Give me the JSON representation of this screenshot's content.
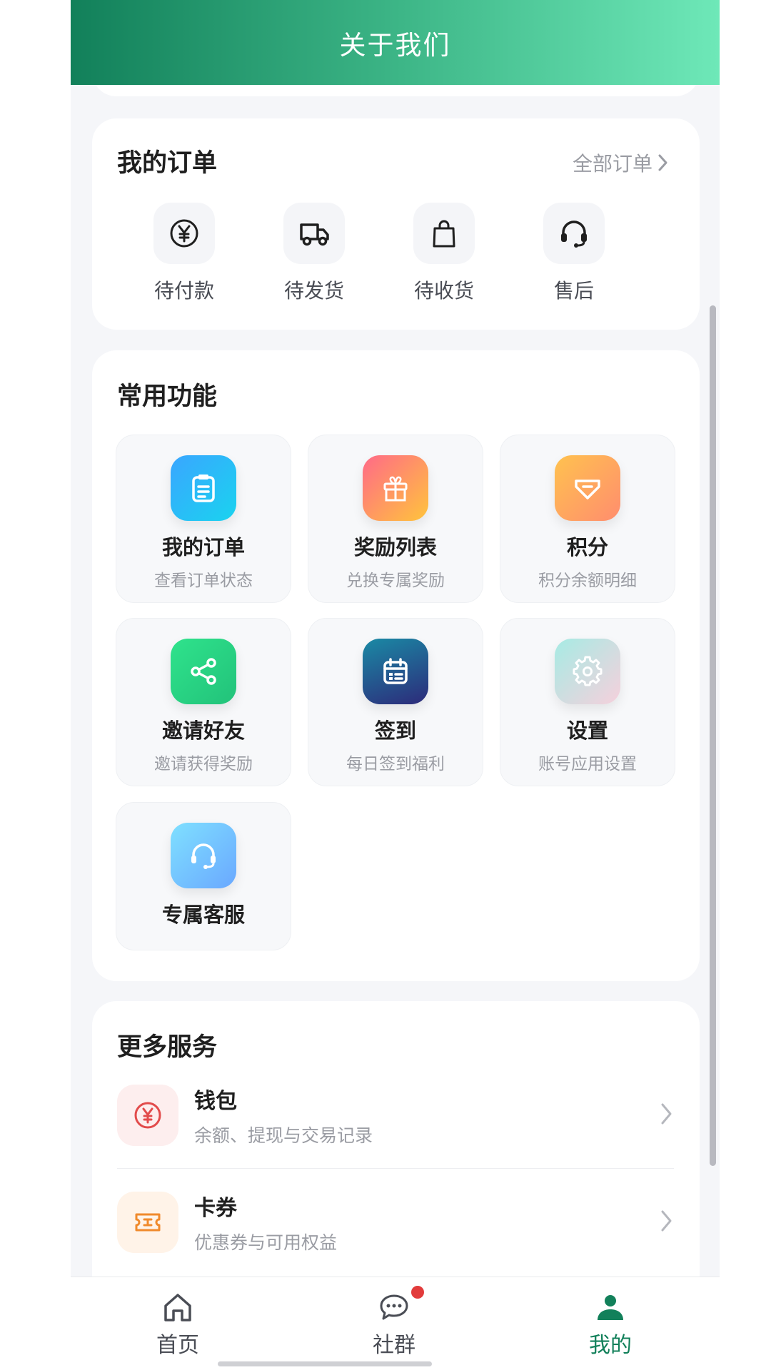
{
  "header": {
    "title": "关于我们"
  },
  "orders": {
    "title": "我的订单",
    "all_link": "全部订单",
    "items": [
      {
        "label": "待付款",
        "icon": "yen-circle-icon"
      },
      {
        "label": "待发货",
        "icon": "truck-icon"
      },
      {
        "label": "待收货",
        "icon": "shopping-bag-icon"
      },
      {
        "label": "售后",
        "icon": "headset-icon"
      }
    ]
  },
  "functions": {
    "title": "常用功能",
    "items": [
      {
        "title": "我的订单",
        "subtitle": "查看订单状态",
        "icon": "clipboard-icon"
      },
      {
        "title": "奖励列表",
        "subtitle": "兑换专属奖励",
        "icon": "gift-icon"
      },
      {
        "title": "积分",
        "subtitle": "积分余额明细",
        "icon": "diamond-tag-icon"
      },
      {
        "title": "邀请好友",
        "subtitle": "邀请获得奖励",
        "icon": "share-icon"
      },
      {
        "title": "签到",
        "subtitle": "每日签到福利",
        "icon": "calendar-icon"
      },
      {
        "title": "设置",
        "subtitle": "账号应用设置",
        "icon": "gear-icon"
      },
      {
        "title": "专属客服",
        "subtitle": "",
        "icon": "headset-icon"
      }
    ]
  },
  "more": {
    "title": "更多服务",
    "items": [
      {
        "title": "钱包",
        "subtitle": "余额、提现与交易记录",
        "icon": "yen-circle-icon"
      },
      {
        "title": "卡券",
        "subtitle": "优惠券与可用权益",
        "icon": "ticket-icon"
      }
    ]
  },
  "tabbar": {
    "items": [
      {
        "label": "首页",
        "icon": "home-icon"
      },
      {
        "label": "社群",
        "icon": "chat-bubble-icon"
      },
      {
        "label": "我的",
        "icon": "user-icon",
        "active": true
      }
    ]
  },
  "colors": {
    "brand_green": "#12805a",
    "header_gradient_end": "#6ee8b8",
    "badge_red": "#e23b3b"
  }
}
